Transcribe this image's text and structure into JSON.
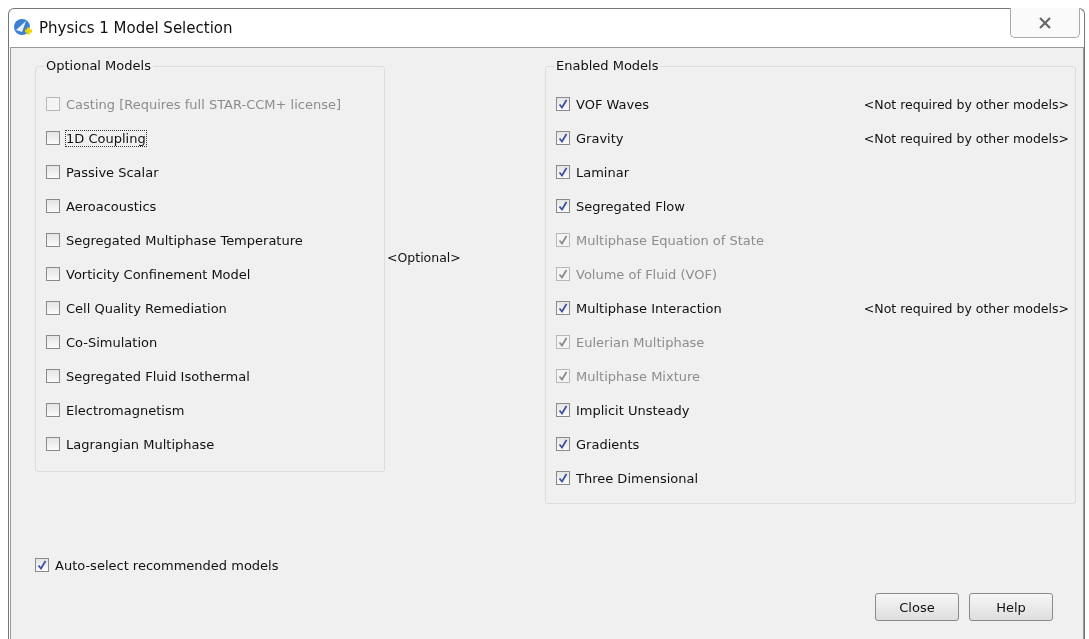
{
  "window": {
    "title": "Physics 1 Model Selection"
  },
  "optional_models": {
    "title": "Optional Models",
    "items": [
      {
        "label": "Casting [Requires full STAR-CCM+ license]",
        "checked": false,
        "disabled": true,
        "focused": false
      },
      {
        "label": "1D Coupling",
        "checked": false,
        "disabled": false,
        "focused": true
      },
      {
        "label": "Passive Scalar",
        "checked": false,
        "disabled": false,
        "focused": false
      },
      {
        "label": "Aeroacoustics",
        "checked": false,
        "disabled": false,
        "focused": false
      },
      {
        "label": "Segregated Multiphase Temperature",
        "checked": false,
        "disabled": false,
        "focused": false
      },
      {
        "label": "Vorticity Confinement Model",
        "checked": false,
        "disabled": false,
        "focused": false
      },
      {
        "label": "Cell Quality Remediation",
        "checked": false,
        "disabled": false,
        "focused": false
      },
      {
        "label": "Co-Simulation",
        "checked": false,
        "disabled": false,
        "focused": false
      },
      {
        "label": "Segregated Fluid Isothermal",
        "checked": false,
        "disabled": false,
        "focused": false
      },
      {
        "label": "Electromagnetism",
        "checked": false,
        "disabled": false,
        "focused": false
      },
      {
        "label": "Lagrangian Multiphase",
        "checked": false,
        "disabled": false,
        "focused": false
      }
    ]
  },
  "middle_label": "<Optional>",
  "enabled_models": {
    "title": "Enabled Models",
    "items": [
      {
        "label": "VOF Waves",
        "checked": true,
        "disabled": false,
        "note": "<Not required by other models>"
      },
      {
        "label": "Gravity",
        "checked": true,
        "disabled": false,
        "note": "<Not required by other models>"
      },
      {
        "label": "Laminar",
        "checked": true,
        "disabled": false
      },
      {
        "label": "Segregated Flow",
        "checked": true,
        "disabled": false
      },
      {
        "label": "Multiphase Equation of State",
        "checked": true,
        "disabled": true
      },
      {
        "label": "Volume of Fluid (VOF)",
        "checked": true,
        "disabled": true
      },
      {
        "label": "Multiphase Interaction",
        "checked": true,
        "disabled": false,
        "note": "<Not required by other models>"
      },
      {
        "label": "Eulerian Multiphase",
        "checked": true,
        "disabled": true
      },
      {
        "label": "Multiphase Mixture",
        "checked": true,
        "disabled": true
      },
      {
        "label": "Implicit Unsteady",
        "checked": true,
        "disabled": false
      },
      {
        "label": "Gradients",
        "checked": true,
        "disabled": false
      },
      {
        "label": "Three Dimensional",
        "checked": true,
        "disabled": false
      }
    ]
  },
  "auto_select": {
    "label": "Auto-select recommended models",
    "checked": true
  },
  "buttons": [
    "Close",
    "Help"
  ]
}
